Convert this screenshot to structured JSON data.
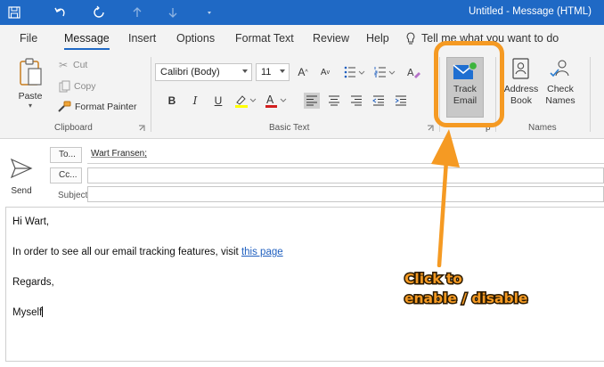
{
  "window": {
    "title": "Untitled  -  Message (HTML)"
  },
  "quick_access": [
    "save-icon",
    "undo-icon",
    "redo-icon",
    "up-arrow-icon",
    "down-arrow-icon",
    "customize-icon"
  ],
  "tabs": [
    {
      "label": "File"
    },
    {
      "label": "Message"
    },
    {
      "label": "Insert"
    },
    {
      "label": "Options"
    },
    {
      "label": "Format Text"
    },
    {
      "label": "Review"
    },
    {
      "label": "Help"
    }
  ],
  "tell_me": "Tell me what you want to do",
  "ribbon": {
    "clipboard": {
      "paste": "Paste",
      "cut": "Cut",
      "copy": "Copy",
      "format_painter": "Format Painter",
      "label": "Clipboard"
    },
    "basic_text": {
      "font": "Calibri (Body)",
      "size": "11",
      "bold": "B",
      "italic": "I",
      "underline": "U",
      "label": "Basic Text"
    },
    "tracking": {
      "track_email": [
        "Track",
        "Email"
      ],
      "label_partial": "p"
    },
    "names": {
      "address_book": [
        "Address",
        "Book"
      ],
      "check_names": [
        "Check",
        "Names"
      ],
      "label": "Names"
    }
  },
  "compose": {
    "send": "Send",
    "to_label": "To...",
    "cc_label": "Cc...",
    "subject_label": "Subject",
    "to_value": "Wart Fransen;",
    "cc_value": "",
    "subject_value": ""
  },
  "body": {
    "greeting": "Hi Wart,",
    "line1_prefix": "In order to see all our email tracking features, visit ",
    "line1_link": "this page",
    "regards": "Regards,",
    "signature": "Myself"
  },
  "annotation": {
    "line1": "Click to",
    "line2": "enable / disable"
  },
  "colors": {
    "title_bar": "#1f69c5",
    "annotation": "#f59a23",
    "link": "#1f5fbf"
  }
}
